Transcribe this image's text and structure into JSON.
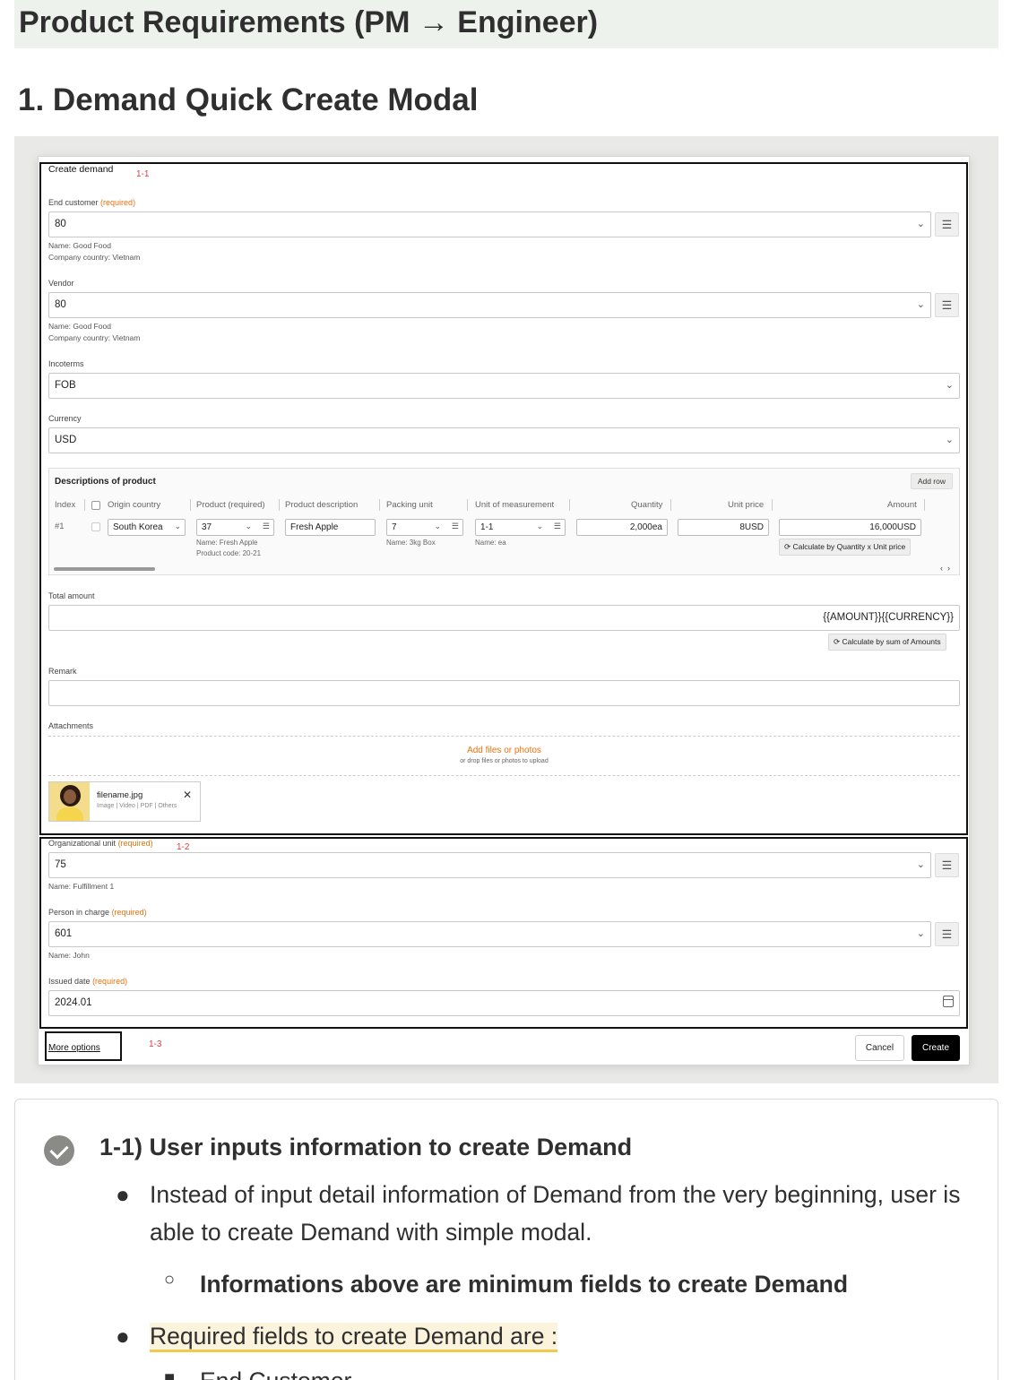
{
  "page": {
    "title": "Product Requirements (PM → Engineer)",
    "section_heading": "1. Demand Quick Create Modal"
  },
  "annotations": {
    "a1": "1-1",
    "a2": "1-2",
    "a3": "1-3"
  },
  "modal": {
    "title": "Create demand",
    "required_tag": "(required)",
    "end_customer": {
      "label": "End customer",
      "value": "80",
      "hint_name": "Name: Good Food",
      "hint_country": "Company country: Vietnam"
    },
    "vendor": {
      "label": "Vendor",
      "value": "80",
      "hint_name": "Name: Good Food",
      "hint_country": "Company country: Vietnam"
    },
    "incoterms": {
      "label": "Incoterms",
      "value": "FOB"
    },
    "currency": {
      "label": "Currency",
      "value": "USD"
    },
    "descriptions": {
      "title": "Descriptions of product",
      "add_row": "Add row",
      "columns": [
        "Index",
        "Origin country",
        "Product (required)",
        "Product description",
        "Packing unit",
        "Unit of measurement",
        "Quantity",
        "Unit price",
        "Amount"
      ],
      "row": {
        "index": "#1",
        "origin_country": "South Korea",
        "product": "37",
        "product_name": "Name: Fresh Apple",
        "product_code": "Product code: 20-21",
        "description": "Fresh Apple",
        "packing_unit": "7",
        "packing_name": "Name: 3kg Box",
        "uom": "1-1",
        "uom_name": "Name: ea",
        "quantity": "2,000ea",
        "unit_price": "8USD",
        "amount": "16,000USD"
      },
      "calc_row": "Calculate by Quantity x Unit price"
    },
    "total_amount": {
      "label": "Total amount",
      "value": "{{AMOUNT}}{{CURRENCY}}",
      "calc": "Calculate by sum of Amounts"
    },
    "remark": {
      "label": "Remark"
    },
    "attachments": {
      "label": "Attachments",
      "add": "Add files or photos",
      "hint": "or drop files or photos to upload",
      "file_name": "filename.jpg",
      "file_types": "Image | Video | PDF | Others"
    },
    "org_unit": {
      "label": "Organizational unit",
      "value": "75",
      "hint": "Name: Fulfillment 1"
    },
    "person_in_charge": {
      "label": "Person in charge",
      "value": "601",
      "hint": "Name: John"
    },
    "issued_date": {
      "label": "Issued date",
      "value": "2024.01"
    },
    "more_options": "More options",
    "cancel": "Cancel",
    "create": "Create"
  },
  "callout": {
    "heading": "1-1) User inputs information to create Demand",
    "bullet1": "Instead of input detail information of Demand from the very beginning, user is able to create Demand with simple modal.",
    "sub_bullet": "Informations above are minimum fields to create Demand",
    "bullet2": "Required fields to create Demand are :",
    "bullet3_partial": "End Customer"
  },
  "icons": {
    "check": "check-circle-icon",
    "list": "list-icon",
    "calendar": "calendar-icon",
    "close": "close-icon",
    "refresh": "refresh-icon",
    "chevron": "chevron-down-icon"
  }
}
